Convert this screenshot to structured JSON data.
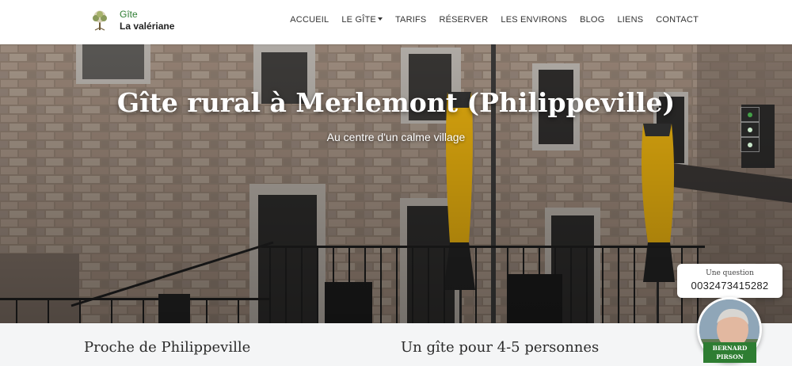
{
  "brand": {
    "line1": "Gîte",
    "line2": "La valériane",
    "logo_icon": "tree-logo-icon"
  },
  "nav": {
    "items": [
      {
        "label": "ACCUEIL",
        "dropdown": false
      },
      {
        "label": "LE GÎTE",
        "dropdown": true
      },
      {
        "label": "TARIFS",
        "dropdown": false
      },
      {
        "label": "RÉSERVER",
        "dropdown": false
      },
      {
        "label": "LES ENVIRONS",
        "dropdown": false
      },
      {
        "label": "BLOG",
        "dropdown": false
      },
      {
        "label": "LIENS",
        "dropdown": false
      },
      {
        "label": "CONTACT",
        "dropdown": false
      }
    ]
  },
  "hero": {
    "title": "Gîte rural à Merlemont (Philippeville)",
    "subtitle": "Au centre d'un calme village",
    "slides": 3,
    "active_slide": 1
  },
  "sections": {
    "left_heading": "Proche de Philippeville",
    "right_heading": "Un gîte pour 4-5 personnes"
  },
  "contact": {
    "question": "Une question",
    "phone": "0032473415282",
    "name_line1": "BERNARD",
    "name_line2": "PIRSON"
  },
  "colors": {
    "accent_green": "#2e7d32",
    "active_dot": "#43a047",
    "umbrella_yellow": "#e8b00f"
  }
}
